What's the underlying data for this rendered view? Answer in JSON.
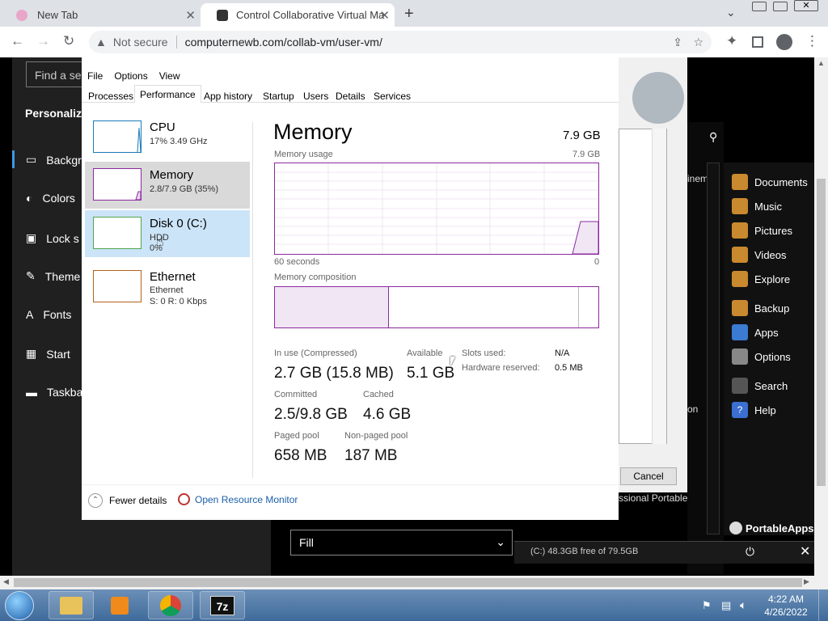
{
  "browser": {
    "tabs": [
      {
        "title": "New Tab"
      },
      {
        "title": "Control Collaborative Virtual Ma"
      }
    ],
    "security_label": "Not secure",
    "url": "computernewb.com/collab-vm/user-vm/"
  },
  "settings": {
    "search_placeholder": "Find a set",
    "section": "Personaliza",
    "items": [
      {
        "label": "Backgr"
      },
      {
        "label": "Colors"
      },
      {
        "label": "Lock s"
      },
      {
        "label": "Theme"
      },
      {
        "label": "Fonts"
      },
      {
        "label": "Start"
      },
      {
        "label": "Taskba"
      }
    ],
    "fill_value": "Fill"
  },
  "task_manager": {
    "menu": [
      "File",
      "Options",
      "View"
    ],
    "tabs": [
      "Processes",
      "Performance",
      "App history",
      "Startup",
      "Users",
      "Details",
      "Services"
    ],
    "active_tab": "Performance",
    "perf_items": [
      {
        "name": "CPU",
        "sub1": "17%  3.49 GHz",
        "sub2": "",
        "color": "#1c7ab8"
      },
      {
        "name": "Memory",
        "sub1": "2.8/7.9 GB (35%)",
        "sub2": "",
        "color": "#8b2a9e"
      },
      {
        "name": "Disk 0 (C:)",
        "sub1": "HDD",
        "sub2": "0%",
        "color": "#4da64d"
      },
      {
        "name": "Ethernet",
        "sub1": "Ethernet",
        "sub2": "S: 0  R: 0 Kbps",
        "color": "#b3631f"
      }
    ],
    "memory": {
      "title": "Memory",
      "total": "7.9 GB",
      "usage_label": "Memory usage",
      "usage_max": "7.9 GB",
      "time_left": "60 seconds",
      "time_right": "0",
      "composition_label": "Memory composition",
      "in_use_label": "In use (Compressed)",
      "in_use_value": "2.7 GB (15.8 MB)",
      "available_label": "Available",
      "available_value": "5.1 GB",
      "slots_label": "Slots used:",
      "slots_value": "N/A",
      "hw_label": "Hardware reserved:",
      "hw_value": "0.5 MB",
      "committed_label": "Committed",
      "committed_value": "2.5/9.8 GB",
      "cached_label": "Cached",
      "cached_value": "4.6 GB",
      "paged_label": "Paged pool",
      "paged_value": "658 MB",
      "nonpaged_label": "Non-paged pool",
      "nonpaged_value": "187 MB"
    },
    "footer": {
      "fewer": "Fewer details",
      "monitor": "Open Resource Monitor"
    }
  },
  "back_window": {
    "cancel": "Cancel",
    "partial_1": "inem",
    "partial_2": "on",
    "partial_3": "ssional Portable"
  },
  "portableapps": {
    "items": [
      {
        "label": "Documents",
        "color": "#c8892f"
      },
      {
        "label": "Music",
        "color": "#c8892f"
      },
      {
        "label": "Pictures",
        "color": "#c8892f"
      },
      {
        "label": "Videos",
        "color": "#c8892f"
      },
      {
        "label": "Explore",
        "color": "#c8892f"
      },
      {
        "label": "Backup",
        "color": "#c8892f"
      },
      {
        "label": "Apps",
        "color": "#3b7bd1"
      },
      {
        "label": "Options",
        "color": "#888888"
      },
      {
        "label": "Search",
        "color": "#555555"
      },
      {
        "label": "Help",
        "color": "#3b6fd1"
      }
    ],
    "brand": "PortableApps.com",
    "drive_info": "(C:) 48.3GB free of 79.5GB"
  },
  "taskbar": {
    "time": "4:22 AM",
    "date": "4/26/2022"
  }
}
